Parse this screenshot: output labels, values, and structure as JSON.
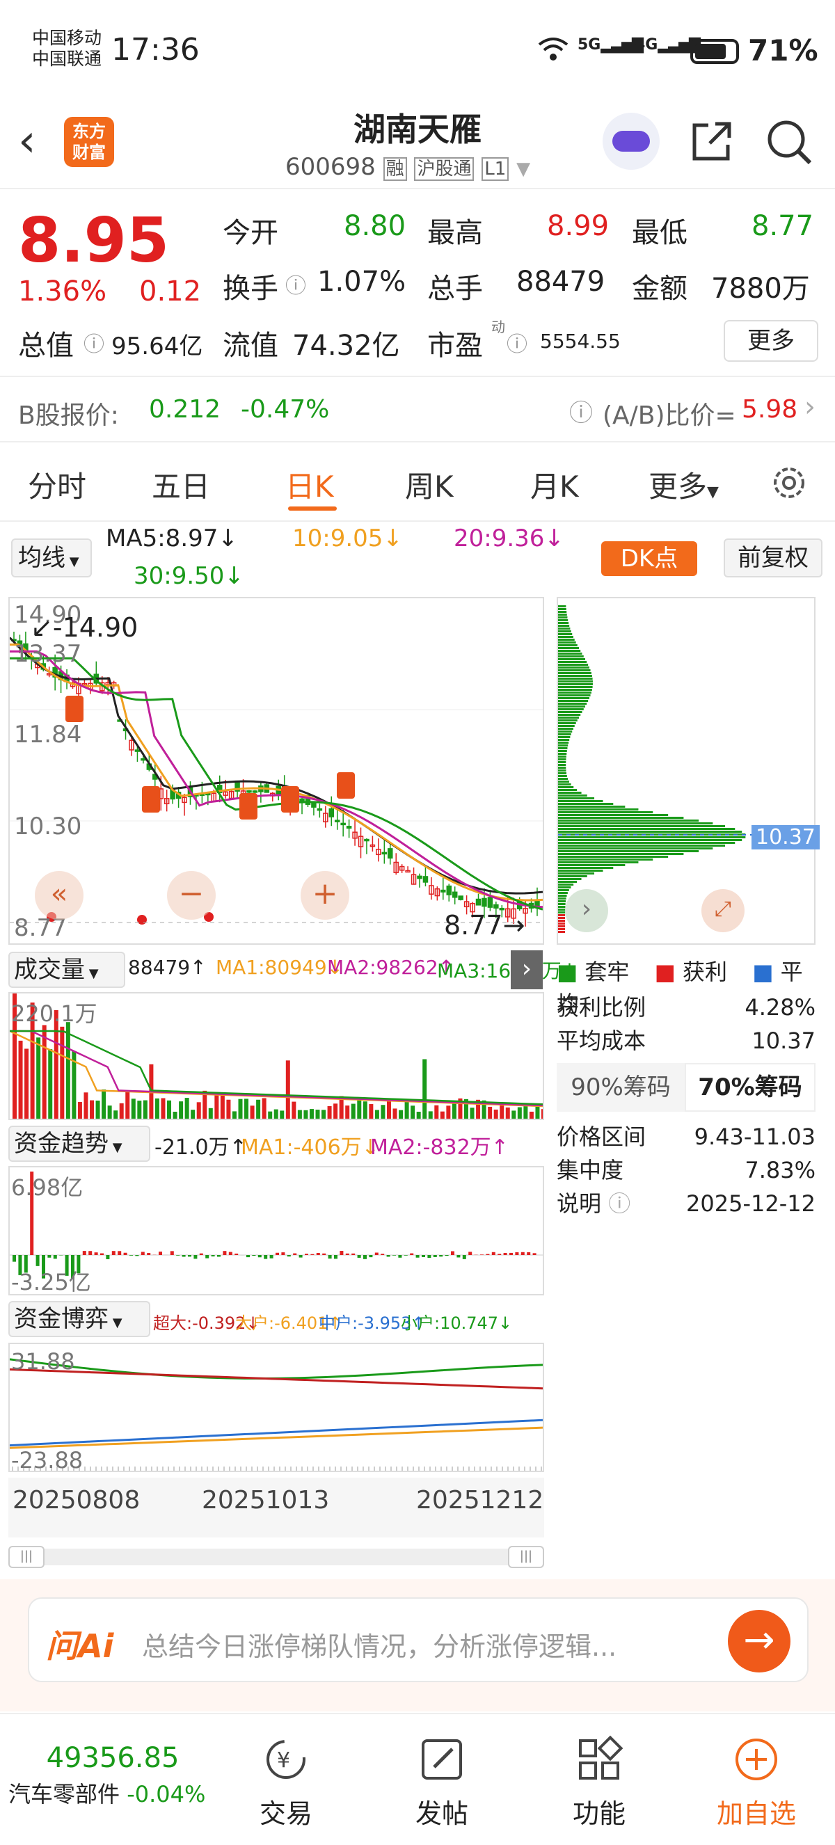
{
  "status": {
    "carrier1": "中国移动",
    "carrier2": "中国联通",
    "time": "17:36",
    "net1": "5G",
    "net2": "4G",
    "battery": "71%"
  },
  "header": {
    "logo_line1": "东方",
    "logo_line2": "财富",
    "name": "湖南天雁",
    "code": "600698",
    "badge1": "融",
    "badge2": "沪股通",
    "badge3": "L1"
  },
  "quote": {
    "price": "8.95",
    "pct": "1.36%",
    "chg": "0.12",
    "open_label": "今开",
    "open": "8.80",
    "high_label": "最高",
    "high": "8.99",
    "low_label": "最低",
    "low": "8.77",
    "turnover_label": "换手",
    "turnover": "1.07%",
    "vol_label": "总手",
    "vol": "88479",
    "amount_label": "金额",
    "amount": "7880万",
    "mcap_label": "总值",
    "mcap": "95.64亿",
    "float_label": "流值",
    "float": "74.32亿",
    "pe_label": "市盈",
    "pe_sup": "动",
    "pe": "5554.55",
    "more": "更多"
  },
  "bshare": {
    "label": "B股报价:",
    "price": "0.212",
    "pct": "-0.47%",
    "ratio_label": "(A/B)比价=",
    "ratio": "5.98"
  },
  "tabs": [
    "分时",
    "五日",
    "日K",
    "周K",
    "月K",
    "更多"
  ],
  "active_tab": "日K",
  "ma": {
    "selector": "均线",
    "ma5": "MA5:8.97↓",
    "ma10": "10:9.05↓",
    "ma20": "20:9.36↓",
    "ma30": "30:9.50↓",
    "dk": "DK点",
    "fq": "前复权"
  },
  "kline": {
    "ymax": "14.90",
    "ymax_ann": "14.90",
    "y2": "11.84",
    "y3": "10.30",
    "ymin": "8.77",
    "ymin_ann": "8.77",
    "ylow2": "13.37"
  },
  "chart_data": {
    "type": "line",
    "title": "",
    "x": [
      "20250808",
      "20251013",
      "20251212"
    ],
    "ylim": [
      8.77,
      14.9
    ],
    "series": [
      {
        "name": "MA5",
        "last": "8.97"
      },
      {
        "name": "10",
        "last": "9.05"
      },
      {
        "name": "20",
        "last": "9.36"
      },
      {
        "name": "30",
        "last": "9.50"
      }
    ]
  },
  "volume": {
    "selector": "成交量",
    "val": "88479↑",
    "ma1": "MA1:80949↓",
    "ma2": "MA2:98262↑",
    "ma3": "MA3:16.65万↓",
    "ymax": "220.1万"
  },
  "flow": {
    "selector": "资金趋势",
    "val": "-21.0万↑",
    "ma1": "MA1:-406万↓",
    "ma2": "MA2:-832万↑",
    "ymax": "6.98亿",
    "ymin": "-3.25亿"
  },
  "game": {
    "selector": "资金博弈",
    "super": "超大:-0.392↓",
    "big": "大户:-6.401↑",
    "mid": "中户:-3.953↑",
    "small": "小户:10.747↓",
    "ymax": "31.88",
    "ymin": "-23.88"
  },
  "xaxis": [
    "20250808",
    "20251013",
    "20251212"
  ],
  "chip": {
    "price_tag": "10.37",
    "legend": [
      "套牢",
      "获利",
      "平均"
    ],
    "rows": [
      {
        "k": "获利比例",
        "v": "4.28%"
      },
      {
        "k": "平均成本",
        "v": "10.37"
      }
    ],
    "tab90": "90%筹码",
    "tab70": "70%筹码",
    "rows2": [
      {
        "k": "价格区间",
        "v": "9.43-11.03"
      },
      {
        "k": "集中度",
        "v": "7.83%"
      },
      {
        "k": "说明",
        "v": "2025-12-12"
      }
    ]
  },
  "ai": {
    "brand": "问Ai",
    "placeholder": "总结今日涨停梯队情况，分析涨停逻辑..."
  },
  "bottom": {
    "index_val": "49356.85",
    "index_name": "汽车零部件",
    "index_pct": "-0.04%",
    "trade": "交易",
    "post": "发帖",
    "func": "功能",
    "add": "加自选"
  }
}
